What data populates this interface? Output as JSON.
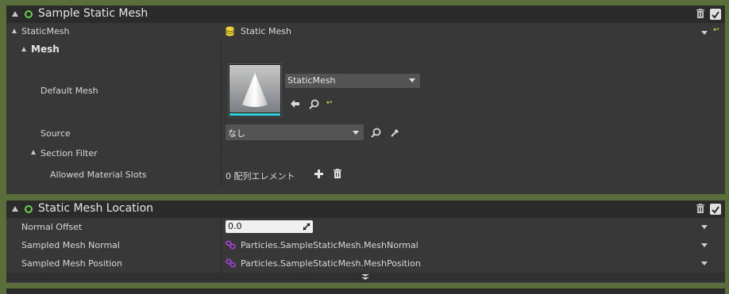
{
  "sample_static_mesh": {
    "title": "Sample Static Mesh",
    "static_mesh_label": "StaticMesh",
    "static_mesh_value": "Static Mesh",
    "mesh_label": "Mesh",
    "default_mesh_label": "Default Mesh",
    "default_mesh_value": "StaticMesh",
    "source_label": "Source",
    "source_value": "なし",
    "section_filter_label": "Section Filter",
    "allowed_slots_label": "Allowed Material Slots",
    "allowed_slots_value": "0 配列エレメント"
  },
  "static_mesh_location": {
    "title": "Static Mesh Location",
    "normal_offset_label": "Normal Offset",
    "normal_offset_value": "0.0",
    "sampled_normal_label": "Sampled Mesh Normal",
    "sampled_normal_value": "Particles.SampleStaticMesh.MeshNormal",
    "sampled_position_label": "Sampled Mesh Position",
    "sampled_position_value": "Particles.SampleStaticMesh.MeshPosition"
  },
  "colors": {
    "accent_green": "#6dd04a",
    "link_purple": "#a040d0",
    "database_yellow": "#e8d23a",
    "highlight_cyan": "#2fd8e0"
  }
}
